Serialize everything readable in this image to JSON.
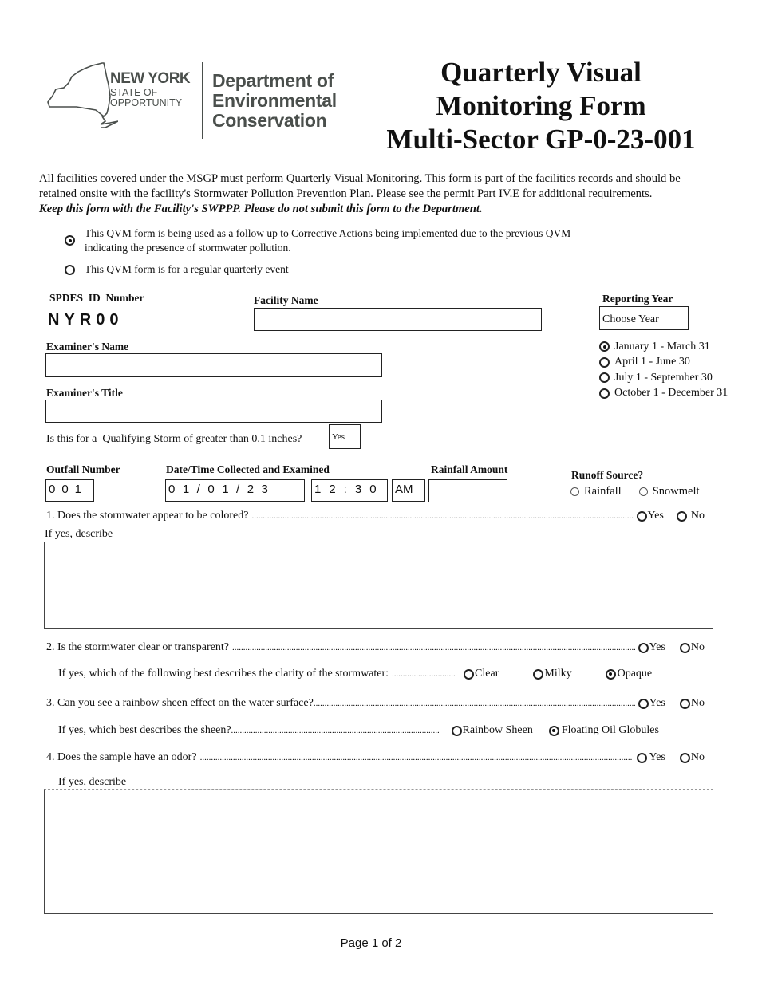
{
  "header": {
    "logo": {
      "state_line1": "NEW YORK",
      "state_line2": "STATE OF",
      "state_line3": "OPPORTUNITY",
      "dept_line1": "Department of",
      "dept_line2": "Environmental",
      "dept_line3": "Conservation"
    },
    "title_line1": "Quarterly Visual",
    "title_line2": "Monitoring Form",
    "title_line3": "Multi-Sector GP-0-23-001"
  },
  "intro": {
    "paragraph": "All facilities covered under the MSGP must perform Quarterly Visual Monitoring. This form is part of the facilities records and should be retained onsite with the facility's Stormwater Pollution Prevention Plan. Please see the permit Part IV.E for additional requirements.",
    "emphasis": "Keep this form with the Facility's SWPPP. Please do not submit this form to the Department."
  },
  "form_purpose": {
    "options": [
      {
        "label_line1": "This QVM form is being used as a follow up to Corrective Actions being implemented due to the previous QVM",
        "label_line2": "indicating the presence of stormwater pollution.",
        "selected": true
      },
      {
        "label_line1": "This QVM form is for a regular quarterly event",
        "label_line2": "",
        "selected": false
      }
    ]
  },
  "fields": {
    "spdes_label": "SPDES  ID  Number",
    "spdes_prefix": "NYR00",
    "spdes_value": "",
    "facility_name_label": "Facility Name",
    "facility_name_value": "",
    "reporting_year_label": "Reporting Year",
    "reporting_year_value": "Choose Year",
    "examiner_name_label": "Examiner's Name",
    "examiner_name_value": "",
    "examiner_title_label": "Examiner's Title",
    "examiner_title_value": "",
    "qualifying_storm_question": "Is this for a  Qualifying Storm of greater than 0.1 inches?",
    "qualifying_storm_value": "Yes",
    "outfall_label": "Outfall Number",
    "outfall_value": "001",
    "datetime_label": "Date/Time Collected and Examined",
    "date_value": "01/01/23",
    "time_value": "12:30",
    "ampm_value": "AM",
    "rainfall_label": "Rainfall Amount",
    "rainfall_value": "",
    "runoff_label": "Runoff Source?",
    "runoff_options": [
      {
        "label": "Rainfall",
        "selected": false
      },
      {
        "label": "Snowmelt",
        "selected": false
      }
    ]
  },
  "quarters": [
    {
      "label": "January 1 - March 31",
      "selected": true
    },
    {
      "label": "April 1 - June 30",
      "selected": false
    },
    {
      "label": "July 1 - September 30",
      "selected": false
    },
    {
      "label": "October 1 - December 31",
      "selected": false
    }
  ],
  "questions": {
    "q1": {
      "text": "1. Does the stormwater appear to be colored?",
      "yes": "Yes",
      "no": "No",
      "answer": null,
      "describe_label": "If yes, describe",
      "describe_value": ""
    },
    "q2": {
      "text": "2. Is the stormwater clear or transparent?",
      "yes": "Yes",
      "no": "No",
      "answer": null,
      "followup": "If yes, which of the following best describes the clarity of the stormwater:",
      "options": [
        {
          "label": "Clear",
          "selected": false
        },
        {
          "label": "Milky",
          "selected": false
        },
        {
          "label": "Opaque",
          "selected": true
        }
      ]
    },
    "q3": {
      "text": "3. Can you see a rainbow sheen effect on the water surface?",
      "yes": "Yes",
      "no": "No",
      "answer": null,
      "followup": "If yes, which best describes the sheen?",
      "options": [
        {
          "label": "Rainbow Sheen",
          "selected": false
        },
        {
          "label": "Floating Oil Globules",
          "selected": true
        }
      ]
    },
    "q4": {
      "text": "4. Does the sample have an odor?",
      "yes": "Yes",
      "no": "No",
      "answer": null,
      "describe_label": "If yes, describe",
      "describe_value": ""
    }
  },
  "footer": {
    "page": "Page 1 of 2"
  }
}
